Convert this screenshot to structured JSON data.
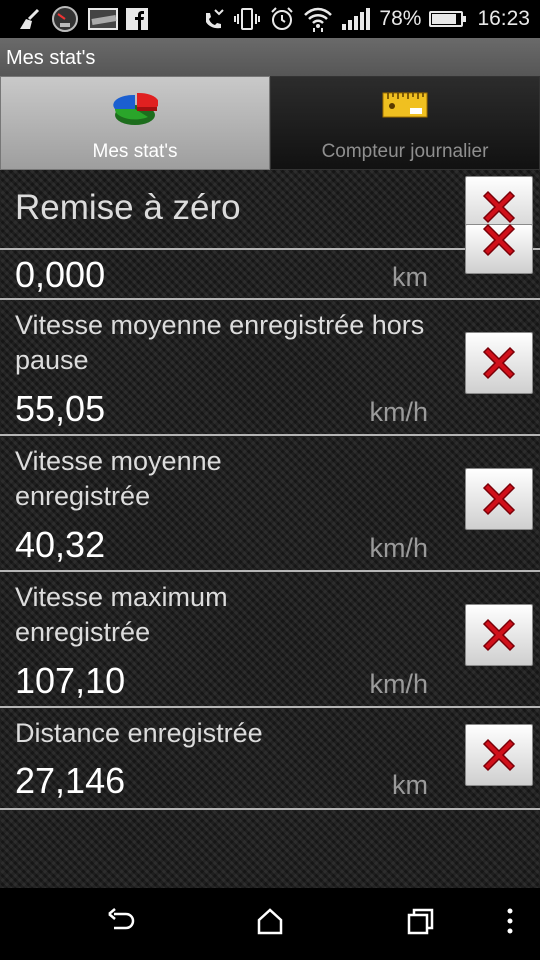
{
  "status_bar": {
    "battery_percent_text": "78%",
    "battery_level": 0.78,
    "time": "16:23",
    "icons": [
      "broom-icon",
      "speedometer-icon",
      "image-icon",
      "facebook-icon",
      "missed-call-icon",
      "vibrate-icon",
      "alarm-icon",
      "wifi-icon",
      "signal-icon",
      "battery-icon"
    ]
  },
  "app": {
    "title": "Mes stat's"
  },
  "tabs": [
    {
      "label": "Mes stat's",
      "icon": "pie-chart-icon",
      "active": true
    },
    {
      "label": "Compteur journalier",
      "icon": "ruler-icon",
      "active": false
    }
  ],
  "reset": {
    "title": "Remise à zéro"
  },
  "rows": [
    {
      "label": "",
      "value": "0,000",
      "unit": "km"
    },
    {
      "label": "Vitesse moyenne enregistrée hors pause",
      "value": "55,05",
      "unit": "km/h"
    },
    {
      "label": "Vitesse moyenne enregistrée",
      "value": "40,32",
      "unit": "km/h"
    },
    {
      "label": "Vitesse maximum enregistrée",
      "value": "107,10",
      "unit": "km/h"
    },
    {
      "label": "Distance enregistrée",
      "value": "27,146",
      "unit": "km"
    }
  ],
  "colors": {
    "delete_x": "#d0101a",
    "title_bar": "#5e5e5e"
  },
  "nav": {
    "icons": [
      "back-icon",
      "home-icon",
      "recents-icon",
      "menu-icon"
    ]
  }
}
